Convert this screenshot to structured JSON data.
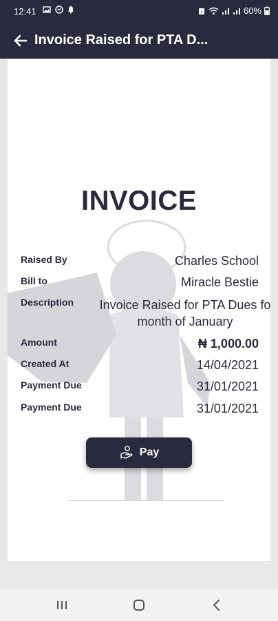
{
  "status_bar": {
    "time": "12:41",
    "battery": "60%"
  },
  "app_bar": {
    "title": "Invoice Raised for PTA D..."
  },
  "invoice": {
    "heading": "INVOICE",
    "rows": [
      {
        "label": "Raised By",
        "value": "Charles School"
      },
      {
        "label": "Bill to",
        "value": "Miracle Bestie"
      },
      {
        "label": "Description",
        "value_line1": "Invoice Raised for PTA Dues fo",
        "value_line2": "month of January"
      },
      {
        "label": "Amount",
        "value": "₦ 1,000.00"
      },
      {
        "label": "Created At",
        "value": "14/04/2021"
      },
      {
        "label": "Payment Due",
        "value": "31/01/2021"
      },
      {
        "label": "Payment Due",
        "value": "31/01/2021"
      }
    ],
    "pay_label": "Pay"
  },
  "colors": {
    "primary": "#2a2a3e",
    "watermark": "#dcdce0",
    "background": "#e8e8e8"
  },
  "icons": {
    "back": "arrow-left-icon",
    "pay": "hand-coin-icon"
  }
}
